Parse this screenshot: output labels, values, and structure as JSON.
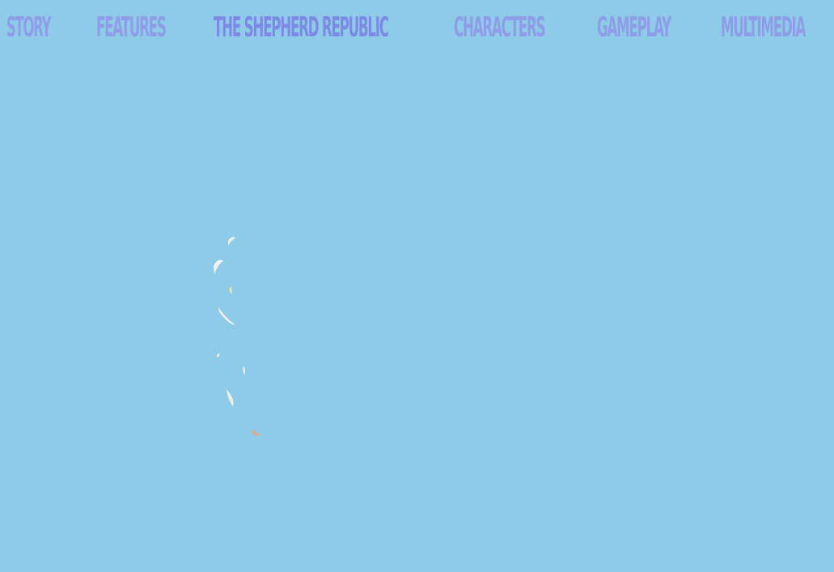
{
  "nav": {
    "items": [
      {
        "label": "STORY"
      },
      {
        "label": "FEATURES"
      },
      {
        "label": "THE SHEPHERD REPUBLIC"
      },
      {
        "label": "CHARACTERS"
      },
      {
        "label": "GAMEPLAY"
      },
      {
        "label": "MULTIMEDIA"
      }
    ]
  },
  "colors": {
    "background": "#8ecbe8",
    "nav_text": "#8f9de8",
    "nav_active": "#7c8ae6",
    "petal_light": "#f4f2e6",
    "petal_orange": "#e8a67a"
  },
  "loader": {
    "icon": "falling-petals-icon"
  }
}
